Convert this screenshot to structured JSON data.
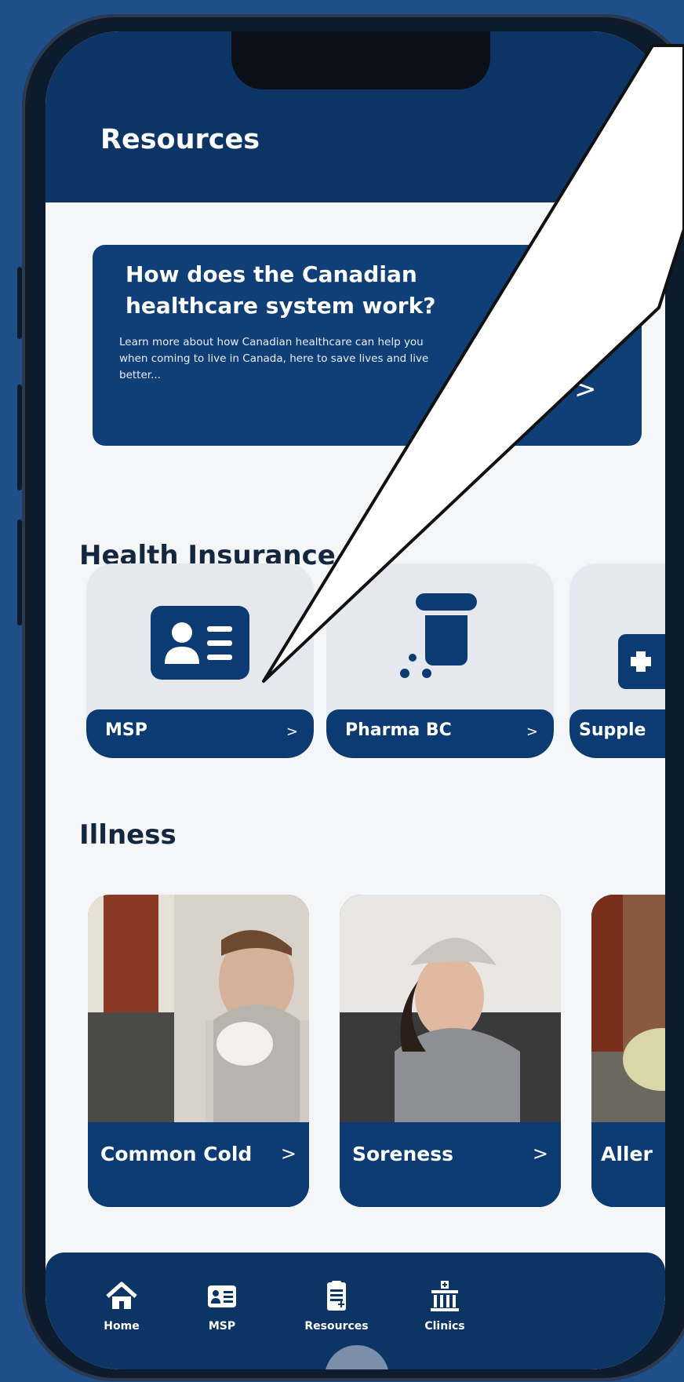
{
  "header": {
    "title": "Resources"
  },
  "hero": {
    "title": "How does the Canadian healthcare system work?",
    "description": "Learn more about how Canadian healthcare can help you when coming to live in Canada, here to save lives and live better...",
    "chevron": ">"
  },
  "insurance": {
    "section_title": "Health Insurance",
    "items": [
      {
        "label": "MSP",
        "icon": "id-card-icon",
        "chevron": ">"
      },
      {
        "label": "Pharma BC",
        "icon": "pill-bottle-icon",
        "chevron": ">"
      },
      {
        "label": "Supple",
        "icon": "plus-icon",
        "chevron": ">"
      }
    ]
  },
  "illness": {
    "section_title": "Illness",
    "items": [
      {
        "label": "Common Cold",
        "chevron": ">"
      },
      {
        "label": "Soreness",
        "chevron": ">"
      },
      {
        "label": "Aller",
        "chevron": ">"
      }
    ]
  },
  "nav": {
    "items": [
      {
        "label": "Home",
        "icon": "house-icon"
      },
      {
        "label": "MSP",
        "icon": "id-card-icon"
      },
      {
        "label": "Resources",
        "icon": "clipboard-icon"
      },
      {
        "label": "Clinics",
        "icon": "hospital-icon"
      }
    ]
  },
  "colors": {
    "primary": "#0c3566",
    "card_blue": "#0f3f76",
    "card_bg": "#e5e9ef",
    "page_bg": "#f5f6f8",
    "frame_bg": "#1f4f88"
  }
}
